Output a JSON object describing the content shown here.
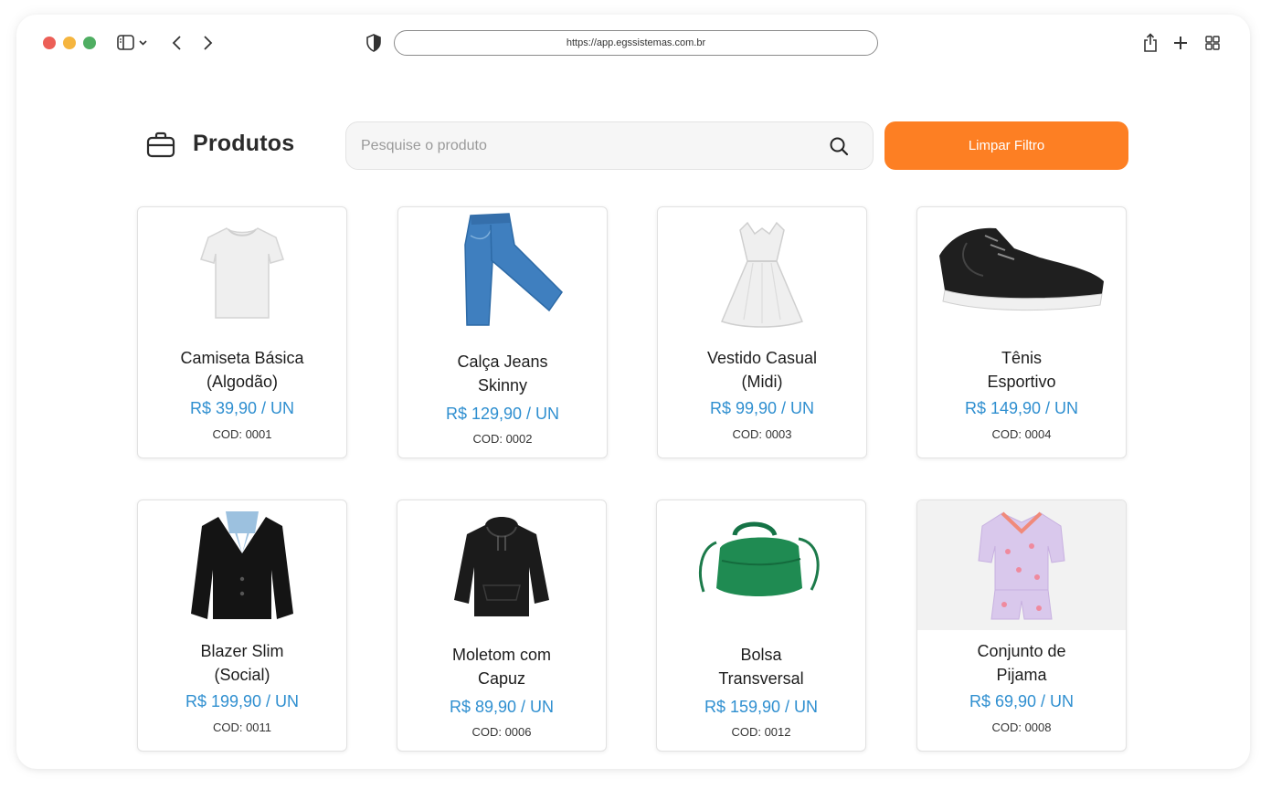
{
  "browser": {
    "url": "https://app.egssistemas.com.br"
  },
  "header": {
    "title": "Produtos",
    "search_placeholder": "Pesquise o produto",
    "clear_label": "Limpar Filtro"
  },
  "products": [
    {
      "name_l1": "Camiseta Básica",
      "name_l2": "(Algodão)",
      "price": "R$ 39,90 / UN",
      "code": "COD: 0001",
      "image": "tshirt-icon"
    },
    {
      "name_l1": "Calça Jeans",
      "name_l2": "Skinny",
      "price": "R$ 129,90 / UN",
      "code": "COD: 0002",
      "image": "jeans-icon"
    },
    {
      "name_l1": "Vestido Casual",
      "name_l2": "(Midi)",
      "price": "R$ 99,90 / UN",
      "code": "COD: 0003",
      "image": "dress-icon"
    },
    {
      "name_l1": "Tênis",
      "name_l2": "Esportivo",
      "price": "R$ 149,90 / UN",
      "code": "COD: 0004",
      "image": "sneaker-icon"
    },
    {
      "name_l1": "Blazer Slim",
      "name_l2": "(Social)",
      "price": "R$ 199,90 / UN",
      "code": "COD: 0011",
      "image": "blazer-icon"
    },
    {
      "name_l1": "Moletom com",
      "name_l2": "Capuz",
      "price": "R$ 89,90 / UN",
      "code": "COD: 0006",
      "image": "hoodie-icon"
    },
    {
      "name_l1": "Bolsa",
      "name_l2": "Transversal",
      "price": "R$ 159,90 / UN",
      "code": "COD: 0012",
      "image": "handbag-icon"
    },
    {
      "name_l1": "Conjunto de",
      "name_l2": "Pijama",
      "price": "R$ 69,90 / UN",
      "code": "COD: 0008",
      "image": "pajama-icon"
    }
  ],
  "colors": {
    "accent": "#fd7f23",
    "price": "#2f8fd0"
  }
}
